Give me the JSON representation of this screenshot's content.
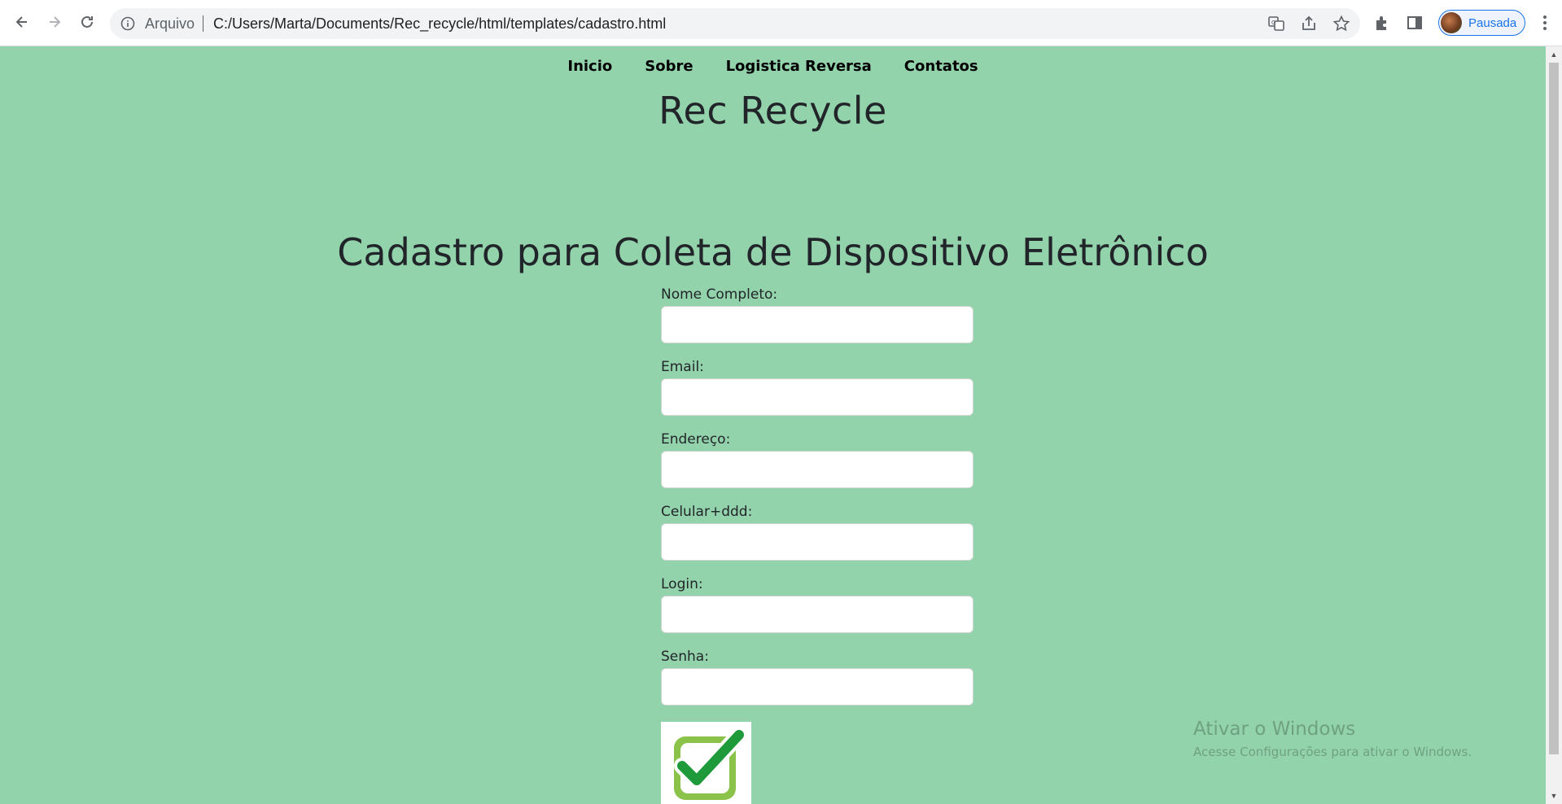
{
  "browser": {
    "scheme_label": "Arquivo",
    "url": "C:/Users/Marta/Documents/Rec_recycle/html/templates/cadastro.html",
    "profile_label": "Pausada"
  },
  "nav": {
    "items": [
      "Inicio",
      "Sobre",
      "Logistica Reversa",
      "Contatos"
    ]
  },
  "site": {
    "title": "Rec Recycle"
  },
  "form": {
    "title": "Cadastro para Coleta de Dispositivo Eletrônico",
    "fields": [
      {
        "label": "Nome Completo:",
        "value": ""
      },
      {
        "label": "Email:",
        "value": ""
      },
      {
        "label": "Endereço:",
        "value": ""
      },
      {
        "label": "Celular+ddd:",
        "value": ""
      },
      {
        "label": "Login:",
        "value": ""
      },
      {
        "label": "Senha:",
        "value": ""
      }
    ],
    "submit_icon": "green-checkmark-icon"
  },
  "watermark": {
    "title": "Ativar o Windows",
    "subtitle": "Acesse Configurações para ativar o Windows."
  },
  "colors": {
    "page_background": "#93d3ac",
    "checkmark_green": "#1f9a3a",
    "checkmark_light": "#8bc34a"
  }
}
